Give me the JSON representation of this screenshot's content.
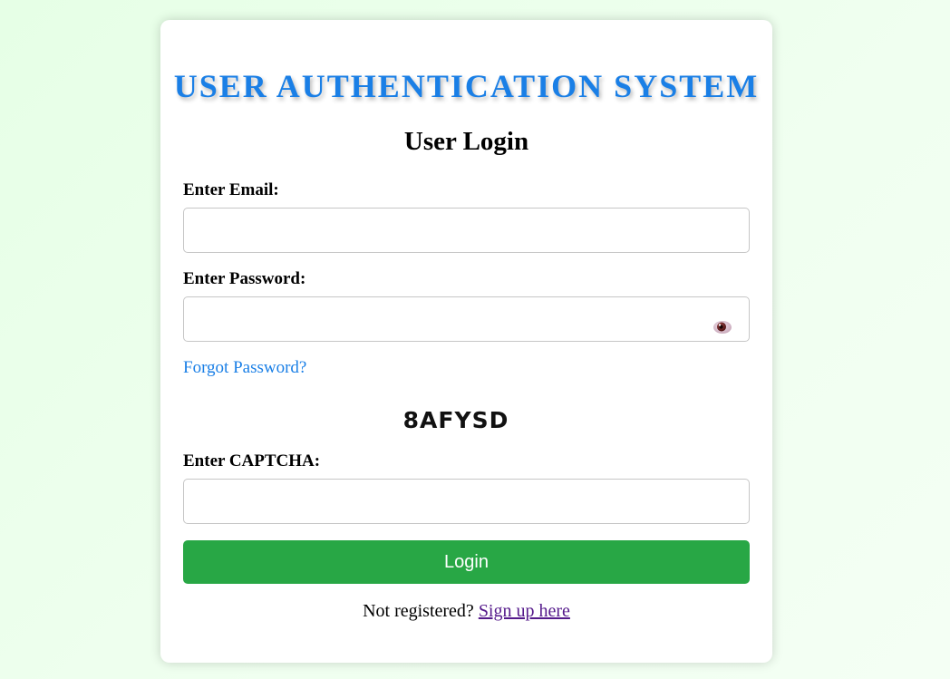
{
  "header": {
    "app_title": "USER AUTHENTICATION SYSTEM",
    "form_title": "User Login"
  },
  "form": {
    "email": {
      "label": "Enter Email:",
      "value": "",
      "placeholder": ""
    },
    "password": {
      "label": "Enter Password:",
      "value": "",
      "placeholder": "",
      "toggle_icon": "eye-icon"
    },
    "forgot_password_link": "Forgot Password?",
    "captcha": {
      "code": "8AFYSD",
      "label": "Enter CAPTCHA:",
      "value": "",
      "placeholder": ""
    },
    "login_button": "Login"
  },
  "footer": {
    "prompt": "Not registered?",
    "signup_link": "Sign up here"
  },
  "colors": {
    "title": "#1a7fe6",
    "link": "#1a7fe6",
    "visited_link": "#551a8b",
    "button": "#28a745",
    "background": "#e6ffe6"
  }
}
